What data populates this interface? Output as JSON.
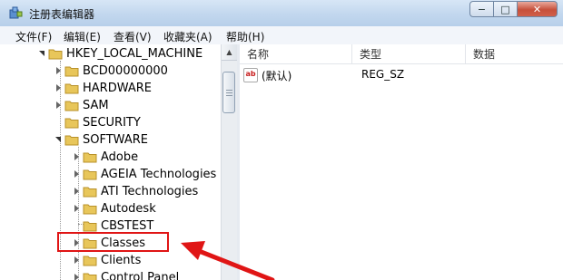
{
  "window": {
    "title": "注册表编辑器",
    "min_label": "−",
    "max_label": "□",
    "close_label": "✕"
  },
  "menu": [
    "文件(F)",
    "编辑(E)",
    "查看(V)",
    "收藏夹(A)",
    "帮助(H)"
  ],
  "tree": {
    "root": "HKEY_LOCAL_MACHINE",
    "items": [
      {
        "label": "BCD00000000",
        "expander": "closed"
      },
      {
        "label": "HARDWARE",
        "expander": "closed"
      },
      {
        "label": "SAM",
        "expander": "closed"
      },
      {
        "label": "SECURITY",
        "expander": "none"
      },
      {
        "label": "SOFTWARE",
        "expander": "open"
      },
      {
        "label": "Adobe",
        "expander": "closed"
      },
      {
        "label": "AGEIA Technologies",
        "expander": "closed"
      },
      {
        "label": "ATI Technologies",
        "expander": "closed"
      },
      {
        "label": "Autodesk",
        "expander": "closed"
      },
      {
        "label": "CBSTEST",
        "expander": "none"
      },
      {
        "label": "Classes",
        "expander": "closed",
        "highlighted": true
      },
      {
        "label": "Clients",
        "expander": "closed"
      },
      {
        "label": "Control Panel",
        "expander": "closed"
      }
    ]
  },
  "list": {
    "columns": [
      "名称",
      "类型",
      "数据"
    ],
    "rows": [
      {
        "name": "(默认)",
        "type": "REG_SZ",
        "data": ""
      }
    ]
  },
  "colors": {
    "highlight": "#e01515",
    "folder": "#e8c65a"
  }
}
